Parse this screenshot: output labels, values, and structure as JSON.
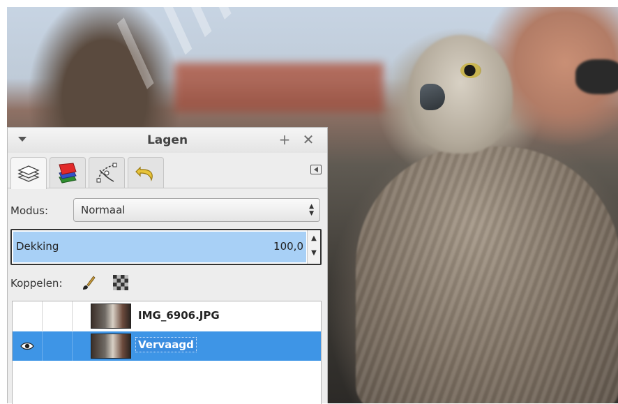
{
  "dialog": {
    "title": "Lagen",
    "tabs": [
      "layers-tab",
      "channels-tab",
      "paths-tab",
      "undo-history-tab"
    ]
  },
  "mode": {
    "label": "Modus:",
    "value": "Normaal"
  },
  "opacity": {
    "label": "Dekking",
    "value": "100,0",
    "fill_fraction": 1.0
  },
  "lock": {
    "label": "Koppelen:"
  },
  "layers": [
    {
      "name": "IMG_6906.JPG",
      "visible": false,
      "selected": false
    },
    {
      "name": "Vervaagd",
      "visible": true,
      "selected": true
    }
  ],
  "colors": {
    "accent": "#3e95e6",
    "opacity_fill": "#a8d0f6"
  }
}
